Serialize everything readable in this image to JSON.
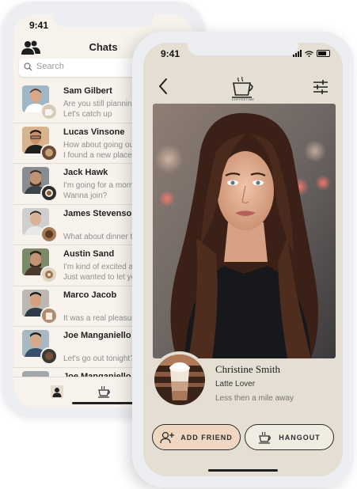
{
  "back_phone": {
    "status_time": "9:41",
    "title": "Chats",
    "search_placeholder": "Search",
    "chats": [
      {
        "name": "Sam Gilbert",
        "line1": "Are you still planning",
        "line2": "Let's catch up"
      },
      {
        "name": "Lucas Vinsone",
        "line1": "How about going out",
        "line2": "I found a new place,"
      },
      {
        "name": "Jack Hawk",
        "line1": "I'm going for a morni",
        "line2": "Wanna join?"
      },
      {
        "name": "James Stevenson",
        "line1": "",
        "line2": "What about dinner to"
      },
      {
        "name": "Austin Sand",
        "line1": "I'm kind of excited ab",
        "line2": "Just wanted to let yo"
      },
      {
        "name": "Marco Jacob",
        "line1": "",
        "line2": "It was a real pleasure"
      },
      {
        "name": "Joe Manganiello",
        "line1": "",
        "line2": "Let's go out tonight?"
      },
      {
        "name": "Joe Manganiello",
        "line1": "",
        "line2": ""
      }
    ],
    "tabs": [
      {
        "icon": "person-icon"
      },
      {
        "icon": "coffee-cup-icon"
      }
    ]
  },
  "front_phone": {
    "status_time": "9:41",
    "logo_text": "COFFEETIME",
    "profile": {
      "name": "Christine Smith",
      "tagline": "Latte Lover",
      "distance": "Less then a mile away"
    },
    "buttons": {
      "add_friend": "ADD FRIEND",
      "hangout": "HANGOUT"
    }
  },
  "colors": {
    "front_background": "#e4dfd2",
    "back_background": "#f7f3ec",
    "add_friend_fill": "#efd7c2",
    "frame": "#eceef1"
  }
}
